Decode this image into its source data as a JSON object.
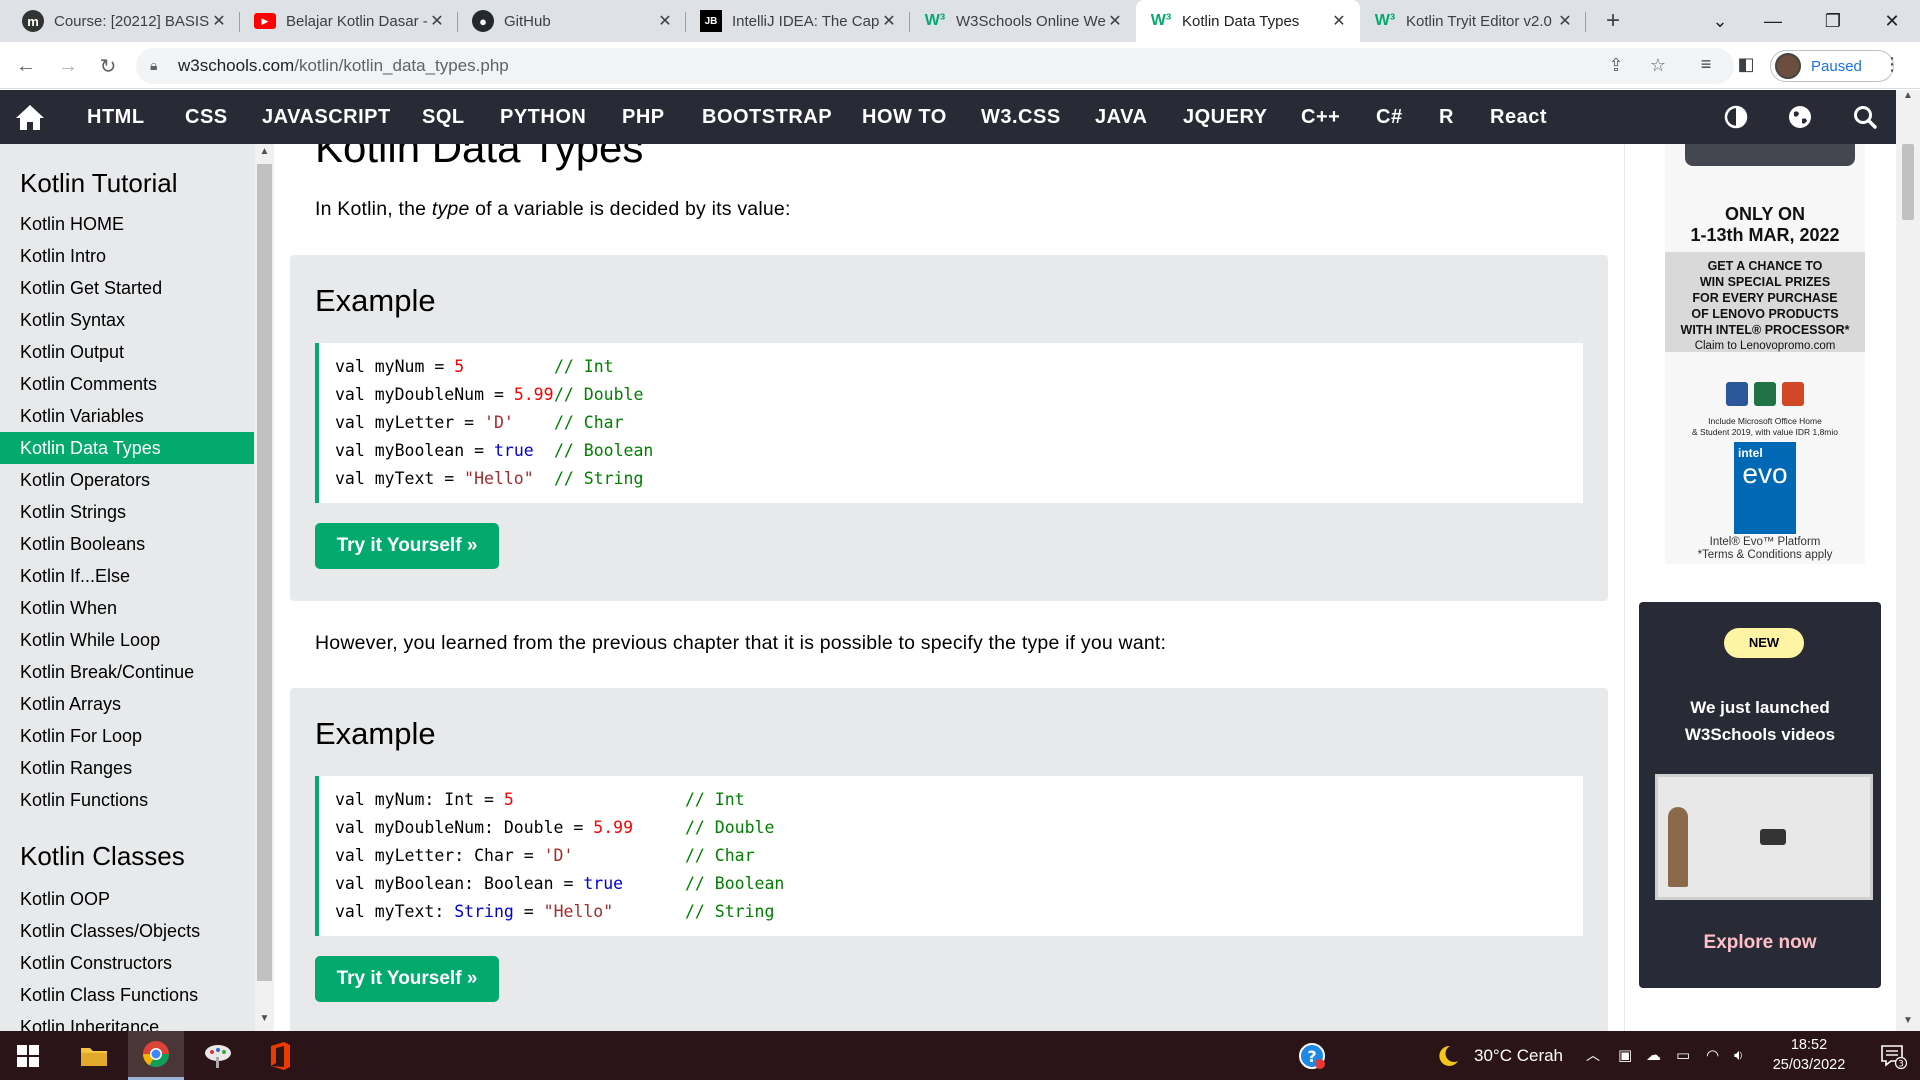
{
  "browser": {
    "tabs": [
      {
        "title": "Course: [20212] BASIS",
        "favicon": "moodle-icon",
        "color": "#ffffff"
      },
      {
        "title": "Belajar Kotlin Dasar -",
        "favicon": "youtube-icon",
        "color": "#ff0000"
      },
      {
        "title": "GitHub",
        "favicon": "github-icon",
        "color": "#24292e"
      },
      {
        "title": "IntelliJ IDEA: The Capa",
        "favicon": "jetbrains-icon",
        "color": "#000000"
      },
      {
        "title": "W3Schools Online We",
        "favicon": "w3schools-icon",
        "color": "#04aa6d"
      },
      {
        "title": "Kotlin Data Types",
        "favicon": "w3schools-icon",
        "color": "#04aa6d"
      },
      {
        "title": "Kotlin Tryit Editor v2.0",
        "favicon": "w3schools-icon",
        "color": "#04aa6d"
      }
    ],
    "active_tab": 5,
    "url_host": "w3schools.com",
    "url_path": "/kotlin/kotlin_data_types.php",
    "profile_label": "Paused"
  },
  "topnav": {
    "items": [
      "HTML",
      "CSS",
      "JAVASCRIPT",
      "SQL",
      "PYTHON",
      "PHP",
      "BOOTSTRAP",
      "HOW TO",
      "W3.CSS",
      "JAVA",
      "JQUERY",
      "C++",
      "C#",
      "R",
      "React"
    ]
  },
  "sidebar": {
    "tutorial_title": "Kotlin Tutorial",
    "tutorial_items": [
      "Kotlin HOME",
      "Kotlin Intro",
      "Kotlin Get Started",
      "Kotlin Syntax",
      "Kotlin Output",
      "Kotlin Comments",
      "Kotlin Variables",
      "Kotlin Data Types",
      "Kotlin Operators",
      "Kotlin Strings",
      "Kotlin Booleans",
      "Kotlin If...Else",
      "Kotlin When",
      "Kotlin While Loop",
      "Kotlin Break/Continue",
      "Kotlin Arrays",
      "Kotlin For Loop",
      "Kotlin Ranges",
      "Kotlin Functions"
    ],
    "active_item": "Kotlin Data Types",
    "classes_title": "Kotlin Classes",
    "classes_items": [
      "Kotlin OOP",
      "Kotlin Classes/Objects",
      "Kotlin Constructors",
      "Kotlin Class Functions",
      "Kotlin Inheritance"
    ]
  },
  "main": {
    "title": "Kotlin Data Types",
    "intro_before": "In Kotlin, the ",
    "intro_em": "type",
    "intro_after": " of a variable is decided by its value:",
    "example_heading": "Example",
    "example1_lines": [
      {
        "pre": "val myNum = ",
        "val": "5",
        "cls": "num",
        "comment": "// Int"
      },
      {
        "pre": "val myDoubleNum = ",
        "val": "5.99",
        "cls": "num",
        "comment": "// Double"
      },
      {
        "pre": "val myLetter = ",
        "val": "'D'",
        "cls": "str",
        "comment": "// Char"
      },
      {
        "pre": "val myBoolean = ",
        "val": "true",
        "cls": "kw",
        "comment": "// Boolean"
      },
      {
        "pre": "val myText = ",
        "val": "\"Hello\"",
        "cls": "str",
        "comment": "// String"
      }
    ],
    "middle_para": "However, you learned from the previous chapter that it is possible to specify the type if you want:",
    "example2_lines": [
      {
        "pre": "val myNum: Int = ",
        "val": "5",
        "cls": "num",
        "comment": "// Int"
      },
      {
        "pre": "val myDoubleNum: Double = ",
        "val": "5.99",
        "cls": "num",
        "comment": "// Double"
      },
      {
        "pre": "val myLetter: Char = ",
        "val": "'D'",
        "cls": "str",
        "comment": "// Char"
      },
      {
        "pre": "val myBoolean: Boolean = ",
        "val": "true",
        "cls": "kw",
        "comment": "// Boolean"
      },
      {
        "pre": "val myText: ",
        "type": "String",
        "mid": " = ",
        "val": "\"Hello\"",
        "cls": "str",
        "comment": "// String"
      }
    ],
    "try_button": "Try it Yourself »"
  },
  "ad": {
    "headline": "ONLY ON\n1-13th MAR, 2022",
    "strip": "GET A CHANCE TO\nWIN SPECIAL PRIZES\nFOR EVERY PURCHASE\nOF LENOVO PRODUCTS\nWITH INTEL® PROCESSOR*",
    "claim": "Claim to Lenovopromo.com",
    "office_note": "Include Microsoft Office Home\n& Student 2019, with value IDR 1,8mio",
    "intel_brand": "intel",
    "intel_evo": "evo",
    "platform": "Intel® Evo™ Platform\n*Terms & Conditions apply"
  },
  "promo": {
    "badge": "NEW",
    "text": "We just launched\nW3Schools videos",
    "link": "Explore now"
  },
  "taskbar": {
    "weather": "30°C  Cerah",
    "time": "18:52",
    "date": "25/03/2022",
    "notifications": "3"
  },
  "colors": {
    "w3_green": "#04aa6d",
    "nav_dark": "#282a35",
    "sidebar_bg": "#e7e9eb",
    "taskbar_bg": "#2a1417"
  }
}
